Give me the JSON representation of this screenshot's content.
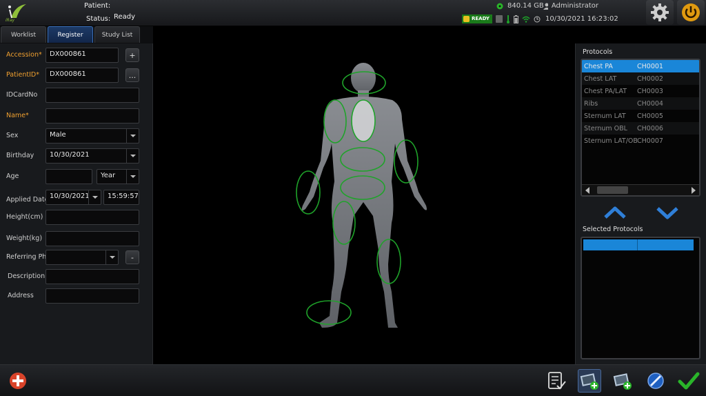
{
  "header": {
    "patient_label": "Patient:",
    "status_label": "Status:",
    "status_value": "Ready",
    "disk_free": "840.14 GB",
    "user": "Administrator",
    "ready_badge": "READY",
    "datetime": "10/30/2021 16:23:02",
    "logo_text": "iRay"
  },
  "tabs": [
    {
      "label": "Worklist",
      "active": false
    },
    {
      "label": "Register",
      "active": true
    },
    {
      "label": "Study List",
      "active": false
    }
  ],
  "form": {
    "accession": {
      "label": "Accession*",
      "value": "DX000861"
    },
    "patient_id": {
      "label": "PatientID*",
      "value": "DX000861"
    },
    "idcard": {
      "label": "IDCardNo",
      "value": ""
    },
    "name": {
      "label": "Name*",
      "value": ""
    },
    "sex": {
      "label": "Sex",
      "value": "Male"
    },
    "birthday": {
      "label": "Birthday",
      "value": "10/30/2021"
    },
    "age": {
      "label": "Age",
      "value": "",
      "unit": "Year"
    },
    "applied_date": {
      "label": "Applied Date",
      "date": "10/30/2021",
      "time": "15:59:57"
    },
    "height": {
      "label": "Height(cm)",
      "value": ""
    },
    "weight": {
      "label": "Weight(kg)",
      "value": ""
    },
    "referring": {
      "label": "Referring Phy",
      "value": ""
    },
    "description": {
      "label": "Description",
      "value": ""
    },
    "address": {
      "label": "Address",
      "value": ""
    },
    "plus_label": "+",
    "dots_label": "...",
    "minus_label": "-"
  },
  "protocols": {
    "title": "Protocols",
    "rows": [
      {
        "name": "Chest PA",
        "code": "CH0001",
        "selected": true
      },
      {
        "name": "Chest LAT",
        "code": "CH0002"
      },
      {
        "name": "Chest PA/LAT",
        "code": "CH0003"
      },
      {
        "name": "Ribs",
        "code": "CH0004"
      },
      {
        "name": "Sternum LAT",
        "code": "CH0005"
      },
      {
        "name": "Sternum OBL",
        "code": "CH0006"
      },
      {
        "name": "Sternum LAT/OBL",
        "code": "CH0007"
      }
    ]
  },
  "selected_protocols": {
    "title": "Selected Protocols"
  },
  "colors": {
    "accent": "#1a86d8",
    "required": "#f0a030",
    "zone": "#1fa32a"
  }
}
